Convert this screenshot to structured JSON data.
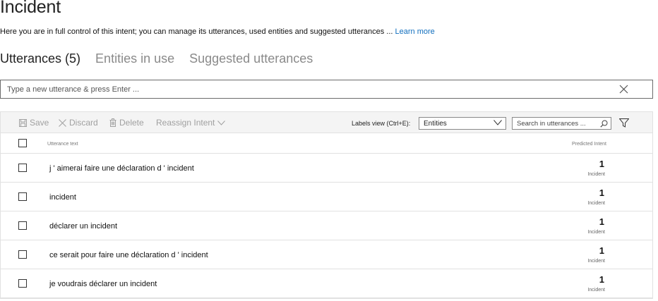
{
  "page": {
    "title": "Incident",
    "description": "Here you are in full control of this intent; you can manage its utterances, used entities and suggested utterances ... ",
    "learn_more": "Learn more"
  },
  "tabs": [
    {
      "label": "Utterances (5)",
      "active": true
    },
    {
      "label": "Entities in use",
      "active": false
    },
    {
      "label": "Suggested utterances",
      "active": false
    }
  ],
  "utterance_input": {
    "placeholder": "Type a new utterance & press Enter ...",
    "value": ""
  },
  "toolbar": {
    "save_label": "Save",
    "discard_label": "Discard",
    "delete_label": "Delete",
    "reassign_label": "Reassign Intent",
    "labels_view_label": "Labels view (Ctrl+E):",
    "labels_view_selected": "Entities",
    "search_placeholder": "Search in utterances ..."
  },
  "table": {
    "col_text": "Utterance text",
    "col_intent": "Predicted Intent",
    "rows": [
      {
        "text": "j ' aimerai faire une déclaration d ' incident",
        "score": "1",
        "intent": "Incident"
      },
      {
        "text": "incident",
        "score": "1",
        "intent": "Incident"
      },
      {
        "text": "déclarer un incident",
        "score": "1",
        "intent": "Incident"
      },
      {
        "text": "ce serait pour faire une déclaration d ' incident",
        "score": "1",
        "intent": "Incident"
      },
      {
        "text": "je voudrais déclarer un incident",
        "score": "1",
        "intent": "Incident"
      }
    ]
  },
  "colors": {
    "link": "#106ebe",
    "disabled_text": "#a0a0a0",
    "toolbar_bg": "#f4f4f4"
  },
  "icons": [
    "close-icon",
    "save-icon",
    "discard-icon",
    "delete-icon",
    "chevron-down-icon",
    "search-icon",
    "filter-icon"
  ]
}
